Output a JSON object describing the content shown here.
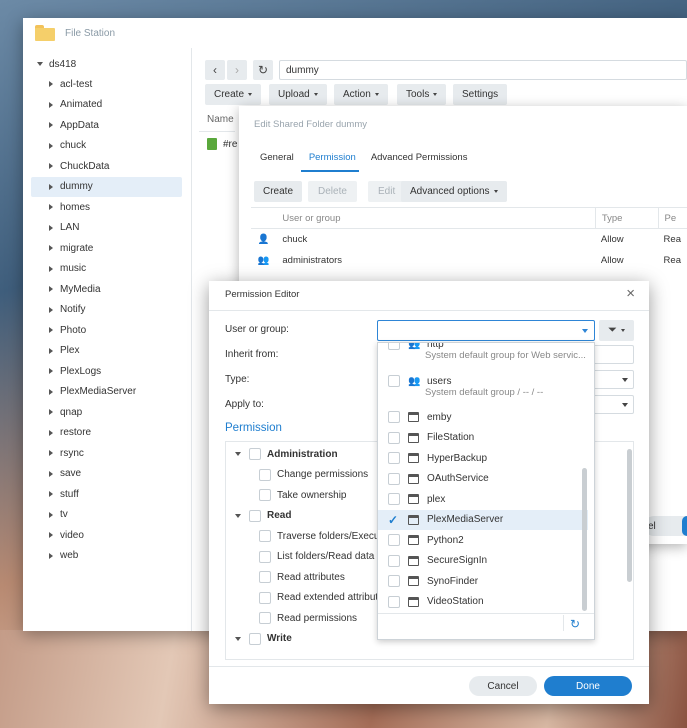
{
  "app": {
    "title": "File Station"
  },
  "tree": {
    "root": "ds418",
    "items": [
      "acl-test",
      "Animated",
      "AppData",
      "chuck",
      "ChuckData",
      "dummy",
      "homes",
      "LAN",
      "migrate",
      "music",
      "MyMedia",
      "Notify",
      "Photo",
      "Plex",
      "PlexLogs",
      "PlexMediaServer",
      "qnap",
      "restore",
      "rsync",
      "save",
      "stuff",
      "tv",
      "video",
      "web"
    ],
    "selected": "dummy"
  },
  "path": {
    "value": "dummy"
  },
  "toolbar": {
    "create": "Create",
    "upload": "Upload",
    "action": "Action",
    "tools": "Tools",
    "settings": "Settings"
  },
  "filelist": {
    "name_header": "Name",
    "first_row": "#re"
  },
  "shared_folder_dialog": {
    "title": "Edit Shared Folder dummy",
    "tabs": [
      "General",
      "Permission",
      "Advanced Permissions"
    ],
    "active_tab": "Permission",
    "buttons": {
      "create": "Create",
      "delete": "Delete",
      "edit": "Edit",
      "advanced": "Advanced options"
    },
    "columns": {
      "user": "User or group",
      "type": "Type",
      "perm": "Pe"
    },
    "rows": [
      {
        "name": "chuck",
        "type": "Allow",
        "perm": "Rea"
      },
      {
        "name": "administrators",
        "type": "Allow",
        "perm": "Rea"
      }
    ],
    "peek_cancel": "el"
  },
  "permission_editor": {
    "title": "Permission Editor",
    "labels": {
      "user_or_group": "User or group:",
      "inherit_from": "Inherit from:",
      "type": "Type:",
      "apply_to": "Apply to:"
    },
    "user_or_group_value": "",
    "permission_header": "Permission",
    "tree": [
      {
        "label": "Administration",
        "level": 0,
        "bold": true
      },
      {
        "label": "Change permissions",
        "level": 1
      },
      {
        "label": "Take ownership",
        "level": 1
      },
      {
        "label": "Read",
        "level": 0,
        "bold": true
      },
      {
        "label": "Traverse folders/Execute",
        "level": 1
      },
      {
        "label": "List folders/Read data",
        "level": 1
      },
      {
        "label": "Read attributes",
        "level": 1
      },
      {
        "label": "Read extended attribute",
        "level": 1
      },
      {
        "label": "Read permissions",
        "level": 1
      },
      {
        "label": "Write",
        "level": 0,
        "bold": true
      }
    ],
    "cancel": "Cancel",
    "done": "Done"
  },
  "dropdown": {
    "groups": [
      {
        "name": "http",
        "desc": "System default group for Web servic..."
      },
      {
        "name": "users",
        "desc": "System default group / -- / --"
      }
    ],
    "apps": [
      "emby",
      "FileStation",
      "HyperBackup",
      "OAuthService",
      "plex",
      "PlexMediaServer",
      "Python2",
      "SecureSignIn",
      "SynoFinder",
      "VideoStation"
    ],
    "selected": "PlexMediaServer",
    "accent": "#1f7ecf"
  }
}
